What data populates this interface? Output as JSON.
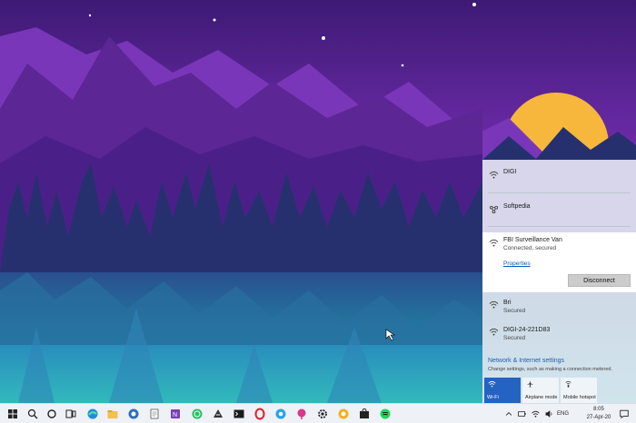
{
  "flyout": {
    "networks_top": [
      {
        "name": "DIGI",
        "icon": "wifi-icon"
      },
      {
        "name": "Softpedia",
        "icon": "hotspot-network-icon"
      }
    ],
    "connected": {
      "name": "FBI Surveillance Van",
      "status": "Connected, secured",
      "properties_label": "Properties",
      "disconnect_label": "Disconnect"
    },
    "networks_bottom": [
      {
        "name": "Bri",
        "status": "Secured"
      },
      {
        "name": "DIGI-24-221D83",
        "status": "Secured"
      }
    ],
    "settings_title": "Network & Internet settings",
    "settings_subtitle": "Change settings, such as making a connection metered.",
    "quick_actions": [
      {
        "label": "Wi-Fi",
        "active": true,
        "icon": "wifi-icon"
      },
      {
        "label": "Airplane mode",
        "active": false,
        "icon": "airplane-icon"
      },
      {
        "label": "Mobile hotspot",
        "active": false,
        "icon": "hotspot-icon"
      }
    ]
  },
  "taskbar": {
    "language": "ENG",
    "time": "8:05",
    "date": "27-Apr-20",
    "pinned_icons": [
      "search-icon",
      "cortana-icon",
      "task-view-icon",
      "edge-icon",
      "file-explorer-icon",
      "browser-icon",
      "notepad-icon",
      "onenote-icon",
      "whatsapp-icon",
      "inkscape-icon",
      "terminal-icon",
      "opera-icon",
      "chrome-icon",
      "bloodhound-icon",
      "settings-icon",
      "mail-icon",
      "store-icon",
      "spotify-icon"
    ]
  },
  "colors": {
    "accent": "#2563c2",
    "sky_top": "#3f1a78",
    "sun": "#f6b73c"
  }
}
